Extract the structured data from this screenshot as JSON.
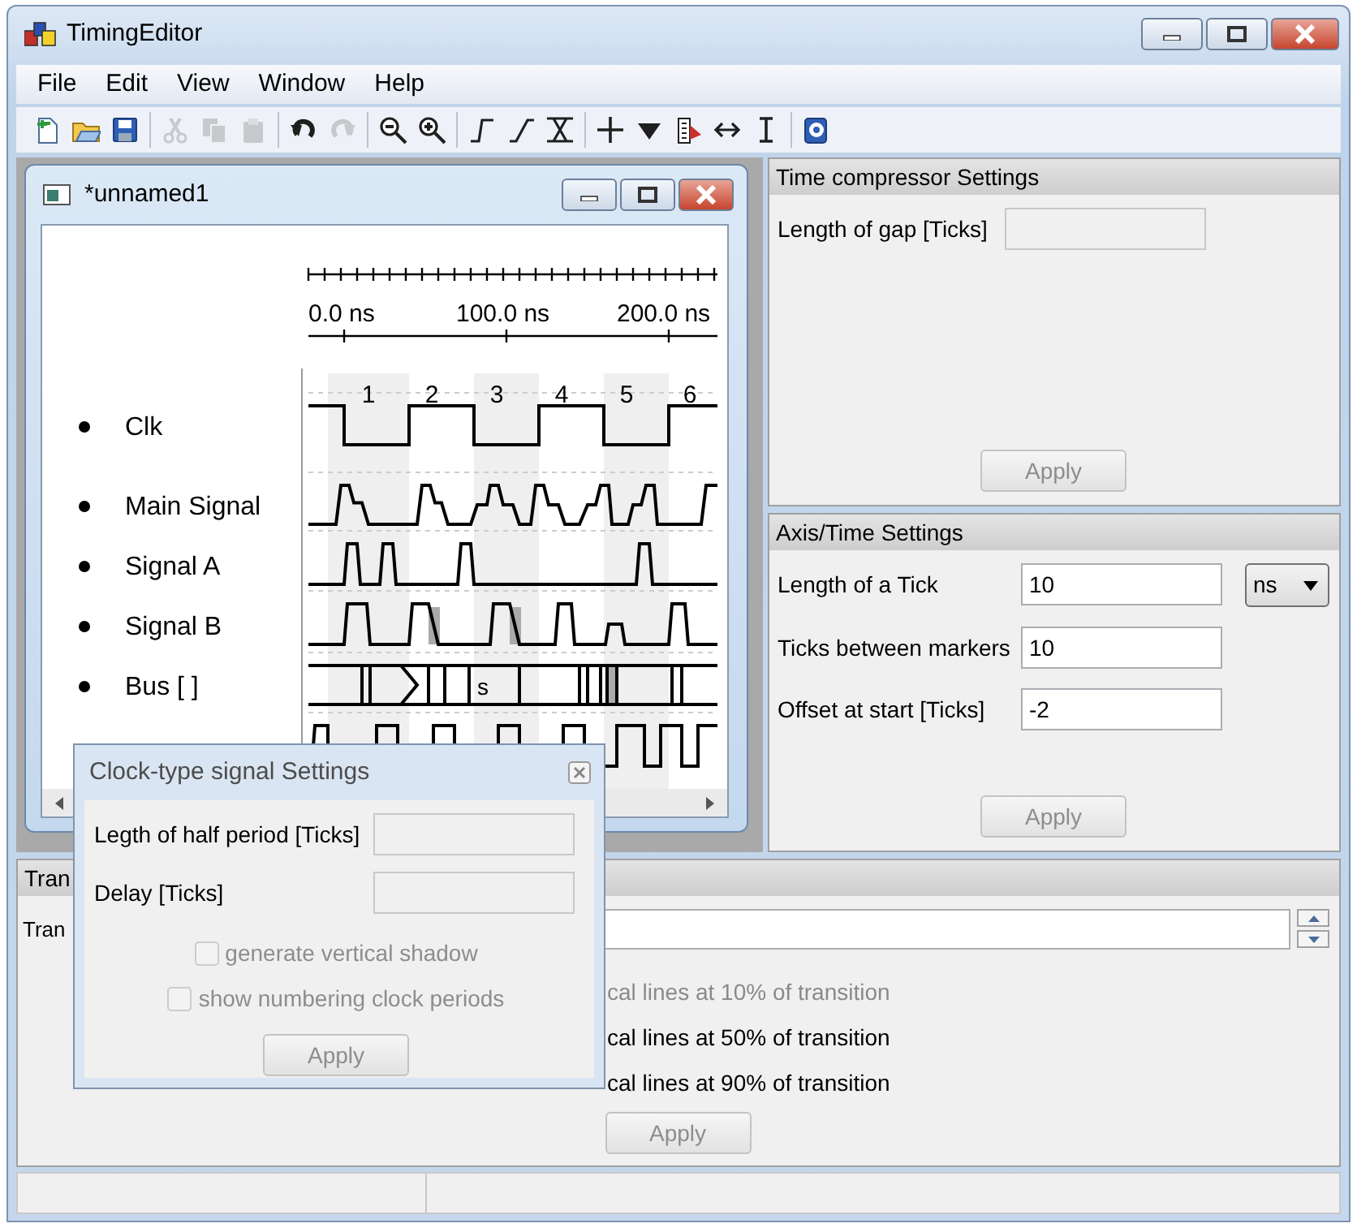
{
  "window": {
    "title": "TimingEditor"
  },
  "menu": [
    "File",
    "Edit",
    "View",
    "Window",
    "Help"
  ],
  "toolbar": [
    [
      {
        "kind": "new",
        "disabled": false
      },
      {
        "kind": "open",
        "disabled": false
      },
      {
        "kind": "save",
        "disabled": false
      }
    ],
    [
      {
        "kind": "cut",
        "disabled": true
      },
      {
        "kind": "copy",
        "disabled": true
      },
      {
        "kind": "paste",
        "disabled": true
      }
    ],
    [
      {
        "kind": "undo",
        "disabled": false
      },
      {
        "kind": "redo",
        "disabled": true
      }
    ],
    [
      {
        "kind": "zoom-out",
        "disabled": false
      },
      {
        "kind": "zoom-in",
        "disabled": false
      }
    ],
    [
      {
        "kind": "rise",
        "disabled": false
      },
      {
        "kind": "slope",
        "disabled": false
      },
      {
        "kind": "cross",
        "disabled": false
      }
    ],
    [
      {
        "kind": "plus",
        "disabled": false
      },
      {
        "kind": "triangle",
        "disabled": false
      },
      {
        "kind": "marker",
        "disabled": false
      },
      {
        "kind": "arrows",
        "disabled": false
      },
      {
        "kind": "ibeam",
        "disabled": false
      }
    ],
    [
      {
        "kind": "help",
        "disabled": false
      }
    ]
  ],
  "document": {
    "title": "*unnamed1"
  },
  "diagram": {
    "axis_labels": [
      "0.0 ns",
      "100.0 ns",
      "200.0 ns"
    ],
    "clock_numbers": [
      "1",
      "2",
      "3",
      "4",
      "5",
      "6"
    ],
    "signals": [
      {
        "name": "Clk",
        "kind": "clock"
      },
      {
        "name": "Main Signal",
        "kind": "signal"
      },
      {
        "name": "Signal A",
        "kind": "signal"
      },
      {
        "name": "Signal B",
        "kind": "signal"
      },
      {
        "name": "Bus [ ]",
        "kind": "bus",
        "value": "s"
      },
      {
        "kind": "clock"
      }
    ]
  },
  "time_compressor": {
    "title": "Time compressor Settings",
    "fields": [
      {
        "label": "Length of gap [Ticks]",
        "disabled": true
      }
    ],
    "apply": {
      "label": "Apply",
      "disabled": true
    }
  },
  "axis_time": {
    "title": "Axis/Time Settings",
    "fields": [
      {
        "label": "Length of a Tick",
        "value": "10",
        "unit": "ns",
        "disabled": false
      },
      {
        "label": "Ticks between markers",
        "value": "10",
        "disabled": false
      },
      {
        "label": "Offset at start [Ticks]",
        "value": "-2",
        "disabled": false
      }
    ],
    "apply": {
      "label": "Apply",
      "disabled": true
    }
  },
  "transition": {
    "title": "Tran",
    "field_label": "Tran",
    "options": [
      {
        "label": "cal lines at 10% of transition",
        "disabled": true
      },
      {
        "label": "cal lines at 50% of transition",
        "disabled": false
      },
      {
        "label": "cal lines at 90% of transition",
        "disabled": false
      }
    ],
    "apply": {
      "label": "Apply",
      "disabled": true
    }
  },
  "clock_dialog": {
    "title": "Clock-type signal Settings",
    "fields": [
      {
        "label": "Legth of half period [Ticks]",
        "disabled": true
      },
      {
        "label": "Delay [Ticks]",
        "disabled": true
      }
    ],
    "checkboxes": [
      {
        "label": "generate vertical shadow",
        "checked": false,
        "disabled": true
      },
      {
        "label": "show numbering clock periods",
        "checked": false,
        "disabled": true
      }
    ],
    "apply": {
      "label": "Apply",
      "disabled": true
    }
  }
}
